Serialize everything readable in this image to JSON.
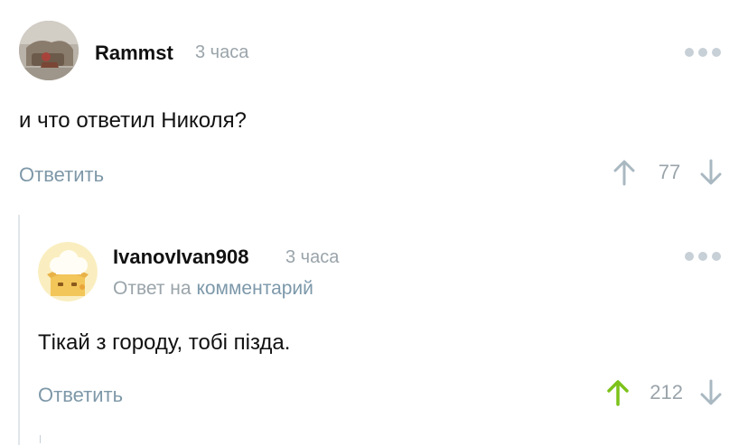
{
  "colors": {
    "upvote_active": "#7cc21a",
    "vote_inactive": "#a9b8c1",
    "link": "#7c98aa"
  },
  "comments": [
    {
      "username": "Rammst",
      "time": "3 часа",
      "text": "и что ответил Николя?",
      "reply_label": "Ответить",
      "score": "77",
      "avatar_icon": "user-photo-avatar",
      "upvoted": false
    },
    {
      "username": "IvanovIvan908",
      "time": "3 часа",
      "reply_to_prefix": "Ответ на",
      "reply_to_link": "комментарий",
      "text": "Тікай з городу, тобі пізда.",
      "reply_label": "Ответить",
      "score": "212",
      "avatar_icon": "chef-avatar",
      "upvoted": true
    }
  ]
}
